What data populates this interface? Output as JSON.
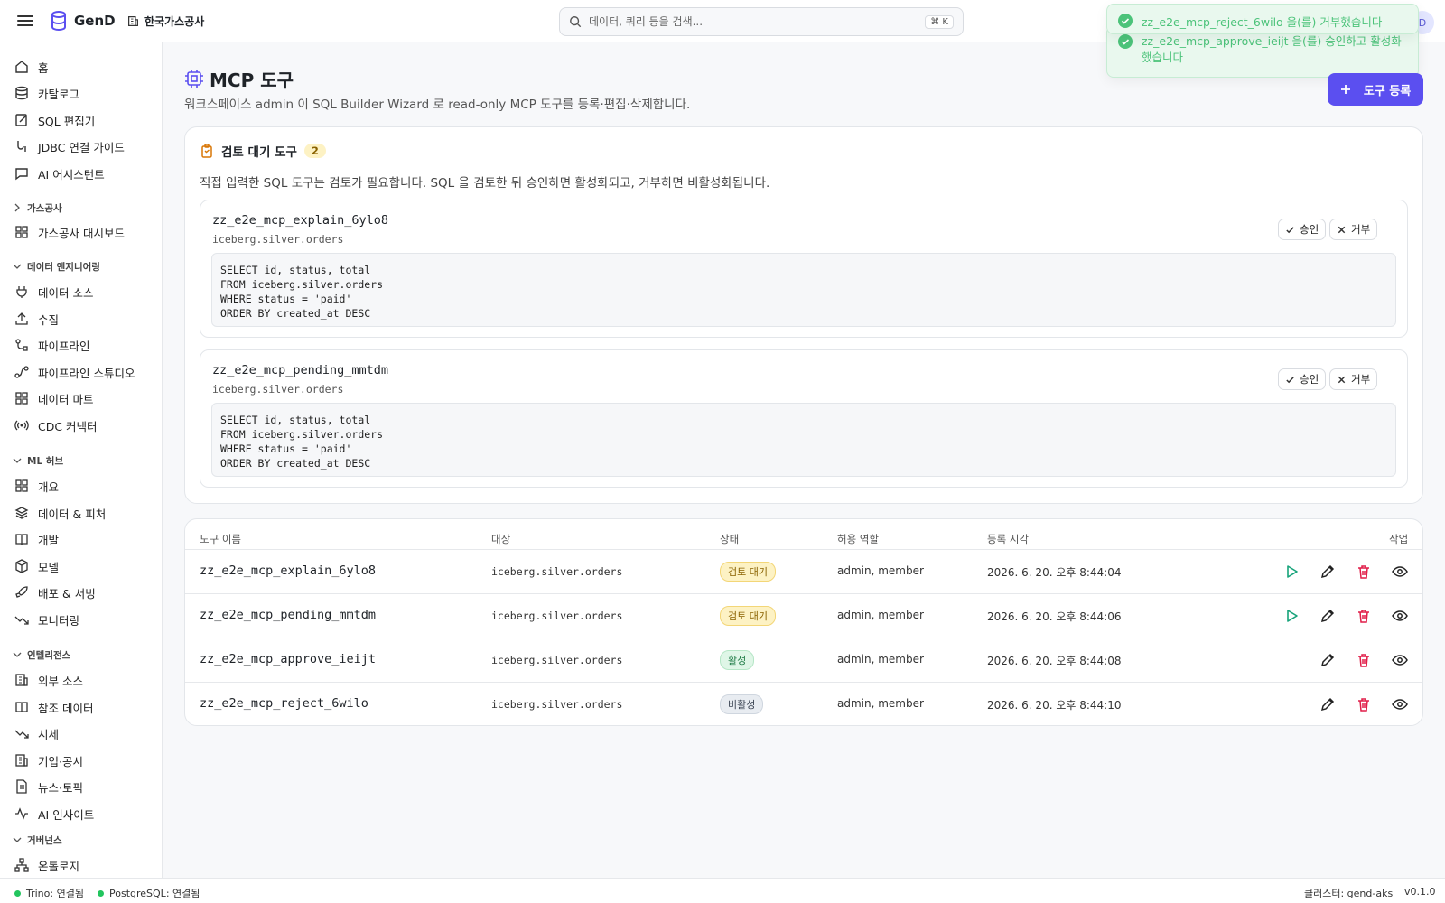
{
  "app": {
    "name": "GenD",
    "org": "한국가스공사"
  },
  "search": {
    "placeholder": "데이터, 쿼리 등을 검색...",
    "shortcut": "⌘ K"
  },
  "user": {
    "initial": "D"
  },
  "toasts": [
    {
      "text": "zz_e2e_mcp_reject_6wilo 을(를) 거부했습니다"
    },
    {
      "text": "zz_e2e_mcp_approve_ieijt 을(를) 승인하고 활성화했습니다"
    }
  ],
  "sidebar": {
    "top": [
      {
        "label": "홈",
        "icon": "home-icon"
      },
      {
        "label": "카탈로그",
        "icon": "database-icon"
      },
      {
        "label": "SQL 편집기",
        "icon": "edit-icon"
      },
      {
        "label": "JDBC 연결 가이드",
        "icon": "plug-link-icon"
      },
      {
        "label": "AI 어시스턴트",
        "icon": "chat-icon"
      }
    ],
    "sections": [
      {
        "title": "가스공사",
        "collapsed": true,
        "items": [
          {
            "label": "가스공사 대시보드",
            "icon": "dashboard-icon"
          }
        ]
      },
      {
        "title": "데이터 엔지니어링",
        "items": [
          {
            "label": "데이터 소스",
            "icon": "plug-icon"
          },
          {
            "label": "수집",
            "icon": "upload-icon"
          },
          {
            "label": "파이프라인",
            "icon": "pipeline-icon"
          },
          {
            "label": "파이프라인 스튜디오",
            "icon": "studio-icon"
          },
          {
            "label": "데이터 마트",
            "icon": "grid-icon"
          },
          {
            "label": "CDC 커넥터",
            "icon": "broadcast-icon"
          }
        ]
      },
      {
        "title": "ML 허브",
        "items": [
          {
            "label": "개요",
            "icon": "grid-icon"
          },
          {
            "label": "데이터 & 피처",
            "icon": "layers-icon"
          },
          {
            "label": "개발",
            "icon": "book-icon"
          },
          {
            "label": "모델",
            "icon": "box-icon"
          },
          {
            "label": "배포 & 서빙",
            "icon": "rocket-icon"
          },
          {
            "label": "모니터링",
            "icon": "trend-icon"
          }
        ]
      },
      {
        "title": "인텔리전스",
        "items": [
          {
            "label": "외부 소스",
            "icon": "building-icon"
          },
          {
            "label": "참조 데이터",
            "icon": "book-icon"
          },
          {
            "label": "시세",
            "icon": "trend-icon"
          },
          {
            "label": "기업·공시",
            "icon": "building-icon"
          },
          {
            "label": "뉴스·토픽",
            "icon": "document-icon"
          },
          {
            "label": "AI 인사이트",
            "icon": "pulse-icon"
          }
        ]
      },
      {
        "title": "거버넌스",
        "items": [
          {
            "label": "온톨로지",
            "icon": "network-icon"
          }
        ]
      }
    ]
  },
  "page": {
    "title": "MCP 도구",
    "description": "워크스페이스 admin 이 SQL Builder Wizard 로 read-only MCP 도구를 등록·편집·삭제합니다.",
    "register_button": "도구 등록"
  },
  "pending": {
    "title": "검토 대기 도구",
    "count": "2",
    "description": "직접 입력한 SQL 도구는 검토가 필요합니다. SQL 을 검토한 뒤 승인하면 활성화되고, 거부하면 비활성화됩니다.",
    "approve_label": "승인",
    "reject_label": "거부",
    "tools": [
      {
        "name": "zz_e2e_mcp_explain_6ylo8",
        "target": "iceberg.silver.orders",
        "sql": "SELECT id, status, total\nFROM iceberg.silver.orders\nWHERE status = 'paid'\nORDER BY created_at DESC"
      },
      {
        "name": "zz_e2e_mcp_pending_mmtdm",
        "target": "iceberg.silver.orders",
        "sql": "SELECT id, status, total\nFROM iceberg.silver.orders\nWHERE status = 'paid'\nORDER BY created_at DESC"
      }
    ]
  },
  "table": {
    "columns": [
      "도구 이름",
      "대상",
      "상태",
      "허용 역할",
      "등록 시각",
      "작업"
    ],
    "rows": [
      {
        "name": "zz_e2e_mcp_explain_6ylo8",
        "target": "iceberg.silver.orders",
        "status": "검토 대기",
        "status_kind": "pending",
        "roles": "admin, member",
        "time": "2026. 6. 20. 오후 8:44:04",
        "runnable": true
      },
      {
        "name": "zz_e2e_mcp_pending_mmtdm",
        "target": "iceberg.silver.orders",
        "status": "검토 대기",
        "status_kind": "pending",
        "roles": "admin, member",
        "time": "2026. 6. 20. 오후 8:44:06",
        "runnable": true
      },
      {
        "name": "zz_e2e_mcp_approve_ieijt",
        "target": "iceberg.silver.orders",
        "status": "활성",
        "status_kind": "active",
        "roles": "admin, member",
        "time": "2026. 6. 20. 오후 8:44:08",
        "runnable": false
      },
      {
        "name": "zz_e2e_mcp_reject_6wilo",
        "target": "iceberg.silver.orders",
        "status": "비활성",
        "status_kind": "inactive",
        "roles": "admin, member",
        "time": "2026. 6. 20. 오후 8:44:10",
        "runnable": false
      }
    ]
  },
  "footer": {
    "trino": "Trino: 연결됨",
    "postgres": "PostgreSQL: 연결됨",
    "cluster": "클러스터: gend-aks",
    "version": "v0.1.0"
  },
  "colors": {
    "accent": "#5b4ff0",
    "success": "#22c55e",
    "danger": "#e11d48",
    "run": "#16a37a"
  }
}
